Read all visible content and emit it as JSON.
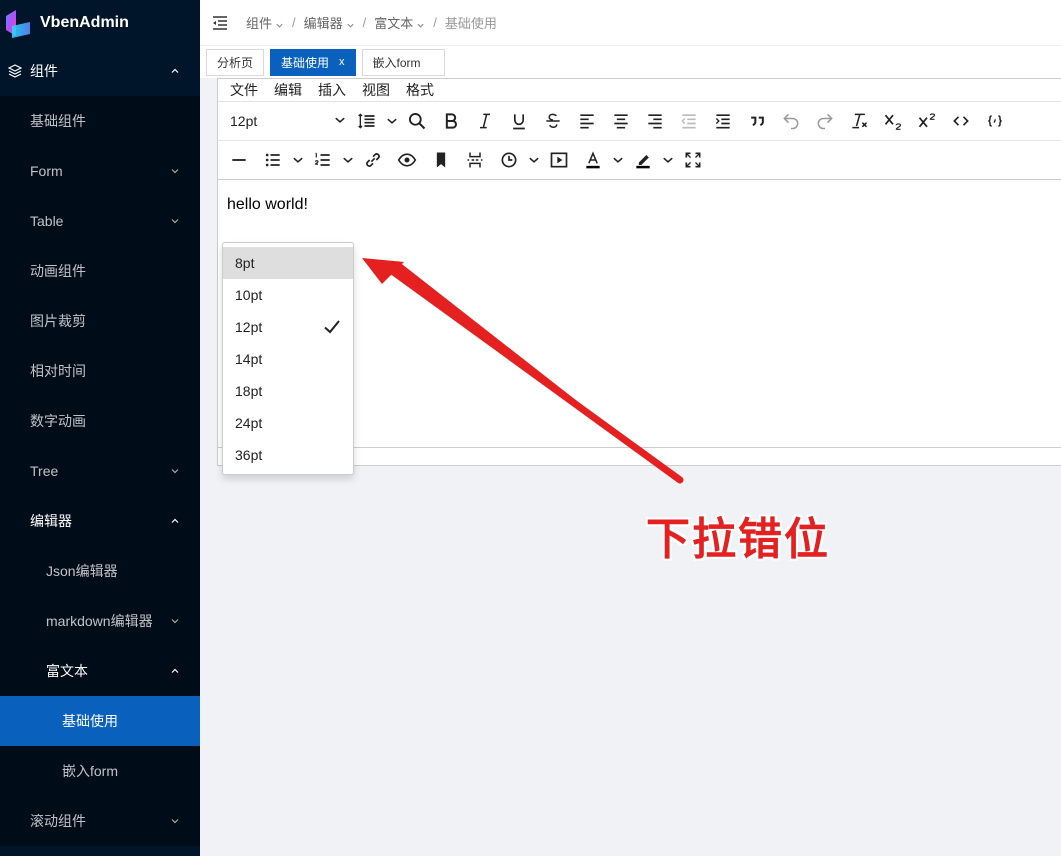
{
  "app": {
    "title": "VbenAdmin"
  },
  "sidebar": {
    "group_label": "组件",
    "items": [
      {
        "label": "基础组件"
      },
      {
        "label": "Form"
      },
      {
        "label": "Table"
      },
      {
        "label": "动画组件"
      },
      {
        "label": "图片裁剪"
      },
      {
        "label": "相对时间"
      },
      {
        "label": "数字动画"
      },
      {
        "label": "Tree"
      },
      {
        "label": "编辑器"
      },
      {
        "label": "Json编辑器"
      },
      {
        "label": "markdown编辑器"
      },
      {
        "label": "富文本"
      },
      {
        "label": "基础使用"
      },
      {
        "label": "嵌入form"
      },
      {
        "label": "滚动组件"
      }
    ]
  },
  "breadcrumb": [
    "组件",
    "编辑器",
    "富文本",
    "基础使用"
  ],
  "tabs": [
    {
      "label": "分析页"
    },
    {
      "label": "基础使用",
      "close": "x"
    },
    {
      "label": "嵌入form"
    }
  ],
  "editor": {
    "menus": [
      "文件",
      "编辑",
      "插入",
      "视图",
      "格式"
    ],
    "font_size_value": "12pt",
    "content": "hello world!"
  },
  "dropdown": {
    "options": [
      "8pt",
      "10pt",
      "12pt",
      "14pt",
      "18pt",
      "24pt",
      "36pt"
    ],
    "selected": "12pt",
    "highlighted": "8pt"
  },
  "annotation": {
    "text": "下拉错位",
    "color": "#e52020"
  },
  "colors": {
    "sidebar_bg": "#001529",
    "active": "#0960bd"
  }
}
